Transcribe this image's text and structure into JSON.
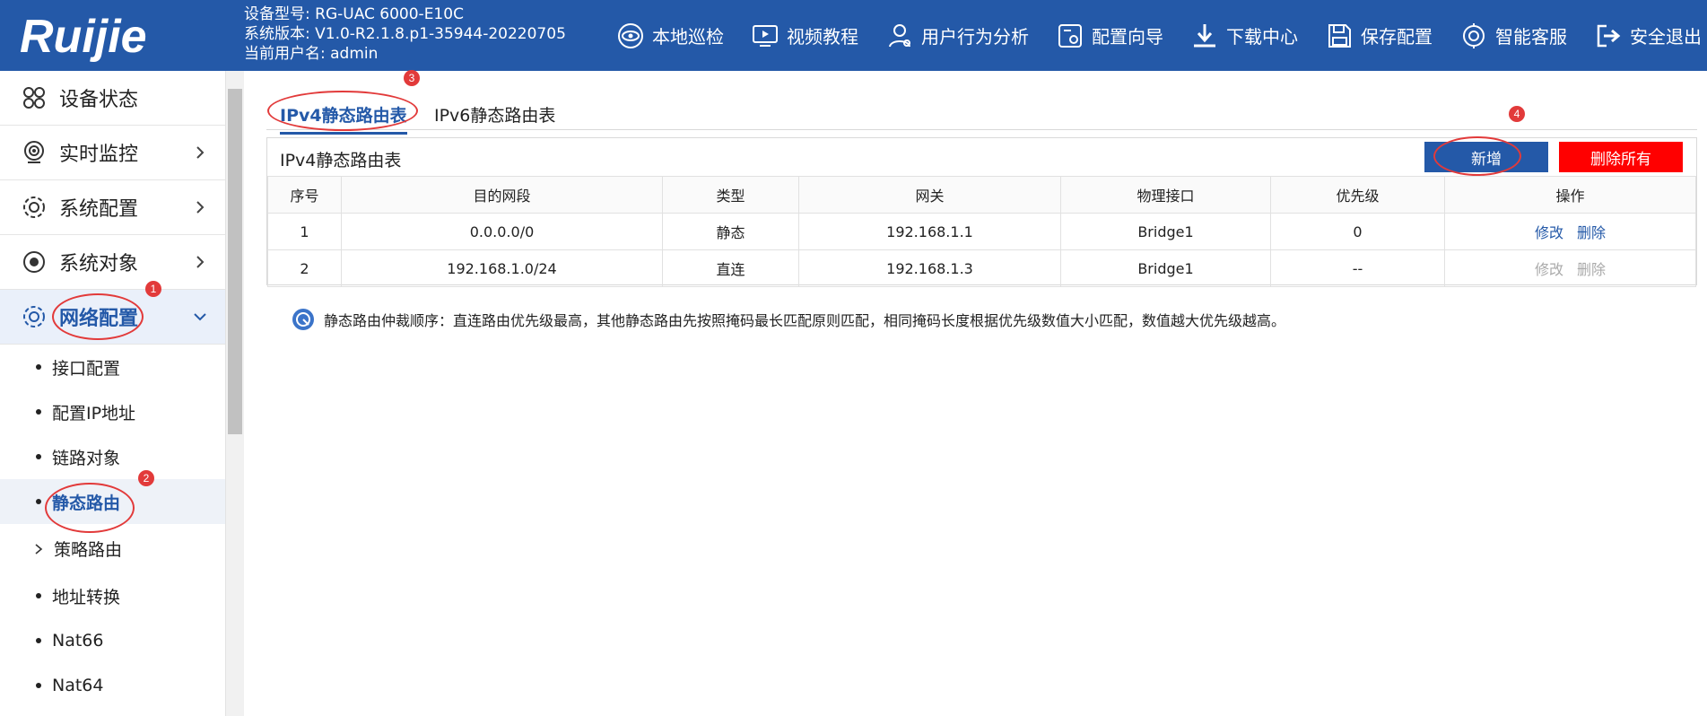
{
  "brand": {
    "logo_text": "Ruijie"
  },
  "device": {
    "model": "设备型号: RG-UAC 6000-E10C",
    "version": "系统版本: V1.0-R2.1.8.p1-35944-20220705",
    "user": "当前用户名: admin"
  },
  "topnav": [
    {
      "label": "本地巡检",
      "icon": "eye-scan-icon"
    },
    {
      "label": "视频教程",
      "icon": "monitor-play-icon"
    },
    {
      "label": "用户行为分析",
      "icon": "user-analytics-icon"
    },
    {
      "label": "配置向导",
      "icon": "config-wizard-icon"
    },
    {
      "label": "下载中心",
      "icon": "download-icon"
    },
    {
      "label": "保存配置",
      "icon": "save-icon"
    },
    {
      "label": "智能客服",
      "icon": "support-icon"
    },
    {
      "label": "安全退出",
      "icon": "logout-icon"
    }
  ],
  "sidebar": {
    "items": [
      {
        "label": "设备状态",
        "icon": "grid-icon"
      },
      {
        "label": "实时监控",
        "icon": "monitor-icon"
      },
      {
        "label": "系统配置",
        "icon": "gear-icon"
      },
      {
        "label": "系统对象",
        "icon": "object-icon"
      },
      {
        "label": "网络配置",
        "icon": "network-gear-icon"
      }
    ],
    "subitems": [
      {
        "label": "接口配置"
      },
      {
        "label": "配置IP地址"
      },
      {
        "label": "链路对象"
      },
      {
        "label": "静态路由"
      },
      {
        "label": "策略路由"
      },
      {
        "label": "地址转换"
      },
      {
        "label": "Nat66"
      },
      {
        "label": "Nat64"
      }
    ]
  },
  "tabs": [
    {
      "label": "IPv4静态路由表"
    },
    {
      "label": "IPv6静态路由表"
    }
  ],
  "panel": {
    "title": "IPv4静态路由表",
    "add_label": "新增",
    "delete_all_label": "删除所有"
  },
  "table": {
    "headers": [
      "序号",
      "目的网段",
      "类型",
      "网关",
      "物理接口",
      "优先级",
      "操作"
    ],
    "rows": [
      [
        "1",
        "0.0.0.0/0",
        "静态",
        "192.168.1.1",
        "Bridge1",
        "0"
      ],
      [
        "2",
        "192.168.1.0/24",
        "直连",
        "192.168.1.3",
        "Bridge1",
        "--"
      ]
    ],
    "edit_label": "修改",
    "delete_label": "删除"
  },
  "note": "静态路由仲裁顺序：直连路由优先级最高，其他静态路由先按照掩码最长匹配原则匹配，相同掩码长度根据优先级数值大小匹配，数值越大优先级越高。",
  "annotations": [
    "1",
    "2",
    "3",
    "4"
  ],
  "colors": {
    "header_bg": "#2459a8",
    "accent": "#2459a8",
    "danger": "#ff0000",
    "annotation": "#e23a3a"
  }
}
